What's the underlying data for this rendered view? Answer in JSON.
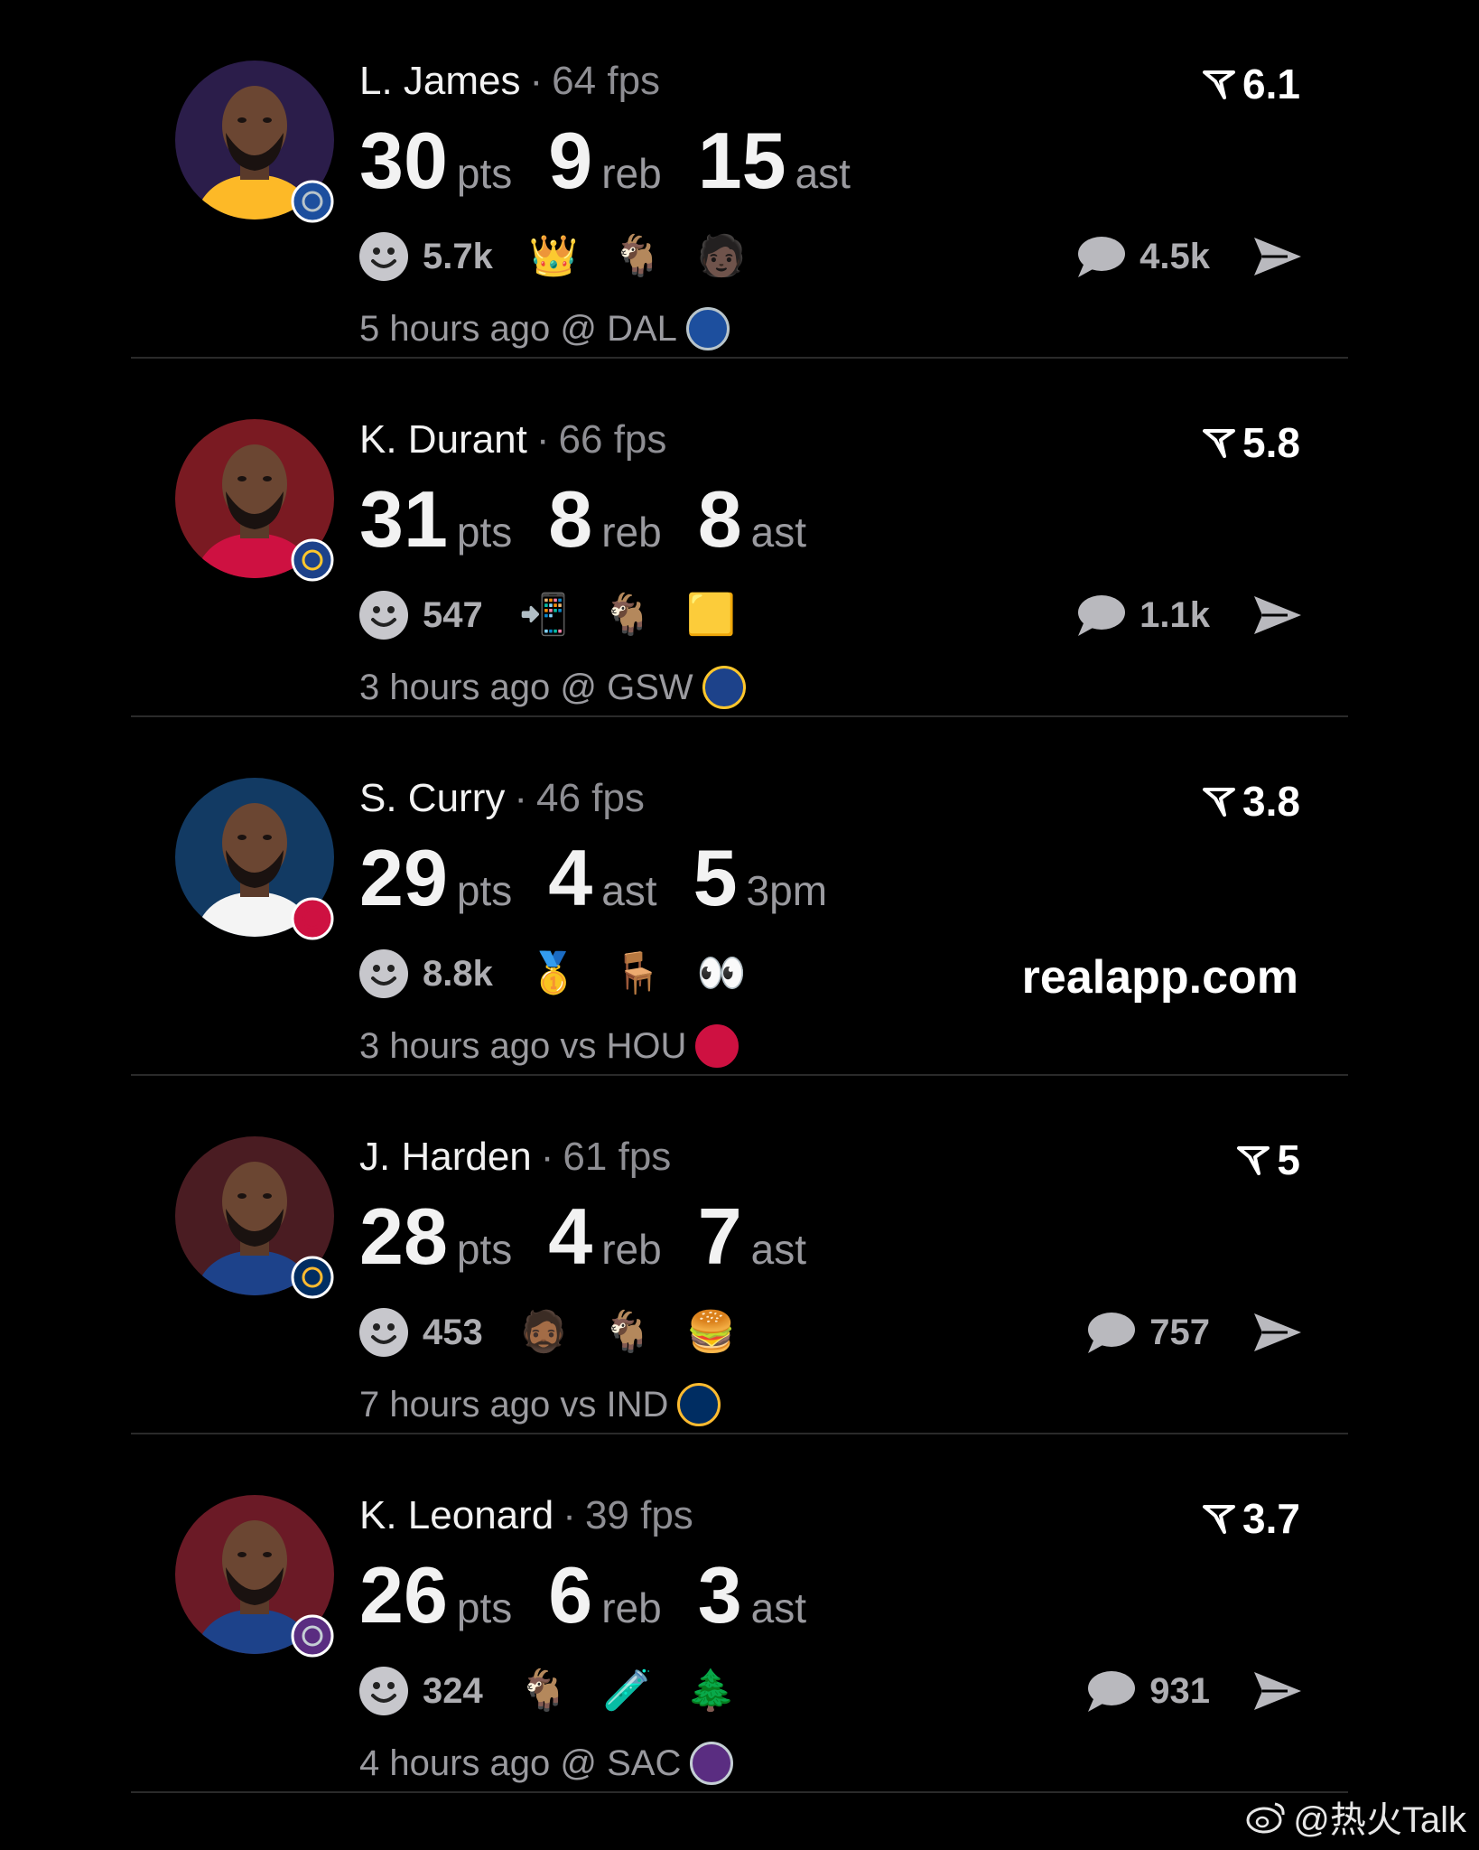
{
  "players": [
    {
      "name": "L. James",
      "fps": "64 fps",
      "rating": "6.1",
      "stats": [
        {
          "num": "30",
          "unit": "pts"
        },
        {
          "num": "9",
          "unit": "reb"
        },
        {
          "num": "15",
          "unit": "ast"
        }
      ],
      "reaction_count": "5.7k",
      "emojis": [
        "👑",
        "🐐",
        "🧑🏿"
      ],
      "comment_count": "4.5k",
      "meta": "5 hours ago @ DAL",
      "colors": {
        "avatar_bg": "#2b1d4a",
        "jersey": "#fdb927",
        "badge": "#1d4f9e",
        "badge_accent": "#b8c4ca"
      }
    },
    {
      "name": "K. Durant",
      "fps": "66 fps",
      "rating": "5.8",
      "stats": [
        {
          "num": "31",
          "unit": "pts"
        },
        {
          "num": "8",
          "unit": "reb"
        },
        {
          "num": "8",
          "unit": "ast"
        }
      ],
      "reaction_count": "547",
      "emojis": [
        "📲",
        "🐐",
        "🟨"
      ],
      "comment_count": "1.1k",
      "meta": "3 hours ago @ GSW",
      "colors": {
        "avatar_bg": "#7a1a22",
        "jersey": "#ce1141",
        "badge": "#1d428a",
        "badge_accent": "#ffc72c"
      }
    },
    {
      "name": "S. Curry",
      "fps": "46 fps",
      "rating": "3.8",
      "stats": [
        {
          "num": "29",
          "unit": "pts"
        },
        {
          "num": "4",
          "unit": "ast"
        },
        {
          "num": "5",
          "unit": "3pm"
        }
      ],
      "reaction_count": "8.8k",
      "emojis": [
        "🥇",
        "🪑",
        "👀"
      ],
      "comment_count": "",
      "meta": "3 hours ago vs HOU",
      "colors": {
        "avatar_bg": "#123a63",
        "jersey": "#f4f4f4",
        "badge": "#ce1141",
        "badge_accent": "#ce1141"
      }
    },
    {
      "name": "J. Harden",
      "fps": "61 fps",
      "rating": "5",
      "stats": [
        {
          "num": "28",
          "unit": "pts"
        },
        {
          "num": "4",
          "unit": "reb"
        },
        {
          "num": "7",
          "unit": "ast"
        }
      ],
      "reaction_count": "453",
      "emojis": [
        "🧔🏾",
        "🐐",
        "🍔"
      ],
      "comment_count": "757",
      "meta": "7 hours ago vs IND",
      "colors": {
        "avatar_bg": "#4a1c22",
        "jersey": "#1d428a",
        "badge": "#002d62",
        "badge_accent": "#fdbb30"
      }
    },
    {
      "name": "K. Leonard",
      "fps": "39 fps",
      "rating": "3.7",
      "stats": [
        {
          "num": "26",
          "unit": "pts"
        },
        {
          "num": "6",
          "unit": "reb"
        },
        {
          "num": "3",
          "unit": "ast"
        }
      ],
      "reaction_count": "324",
      "emojis": [
        "🐐",
        "🧪",
        "🌲"
      ],
      "comment_count": "931",
      "meta": "4 hours ago @ SAC",
      "colors": {
        "avatar_bg": "#6b1a26",
        "jersey": "#1d428a",
        "badge": "#5a2d81",
        "badge_accent": "#c4ced4"
      }
    }
  ],
  "brand": "realapp.com",
  "watermark": "@热火Talk"
}
